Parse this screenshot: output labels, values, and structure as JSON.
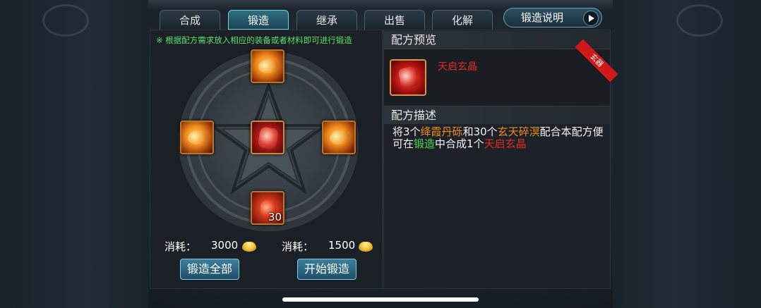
{
  "tabs": [
    "合成",
    "锻造",
    "继承",
    "出售",
    "化解"
  ],
  "active_tab": "锻造",
  "help_button": "锻造说明",
  "hint": "※ 根据配方需求放入相应的装备或者材料即可进行锻造",
  "materials": {
    "center": {
      "icon": "red-crystal-icon"
    },
    "top": {
      "icon": "gold-ore-icon"
    },
    "left": {
      "icon": "gold-ore-icon"
    },
    "right": {
      "icon": "gold-ore-icon"
    },
    "bottom": {
      "icon": "red-fragment-icon",
      "quantity": "30"
    }
  },
  "cost_left": {
    "label": "消耗：",
    "value": "3000"
  },
  "cost_right": {
    "label": "消耗：",
    "value": "1500"
  },
  "buttons": {
    "forge_all": "锻造全部",
    "start_forge": "开始锻造"
  },
  "preview": {
    "header": "配方预览",
    "item_name": "天启玄晶",
    "badge": "玄器"
  },
  "description": {
    "header": "配方描述",
    "parts": [
      {
        "text": "将3个",
        "style": "normal"
      },
      {
        "text": "绛霞丹砾",
        "style": "orange"
      },
      {
        "text": "和30个",
        "style": "normal"
      },
      {
        "text": "玄天碎溟",
        "style": "orange"
      },
      {
        "text": "配合本配方便可在",
        "style": "normal"
      },
      {
        "text": "锻造",
        "style": "green"
      },
      {
        "text": "中合成1个",
        "style": "normal"
      },
      {
        "text": "天启玄晶",
        "style": "red"
      }
    ]
  },
  "colors": {
    "active_tab": "#2f6f80",
    "hint_green": "#5be06a",
    "item_red": "#e22a22",
    "highlight_orange": "#f08a1c"
  }
}
